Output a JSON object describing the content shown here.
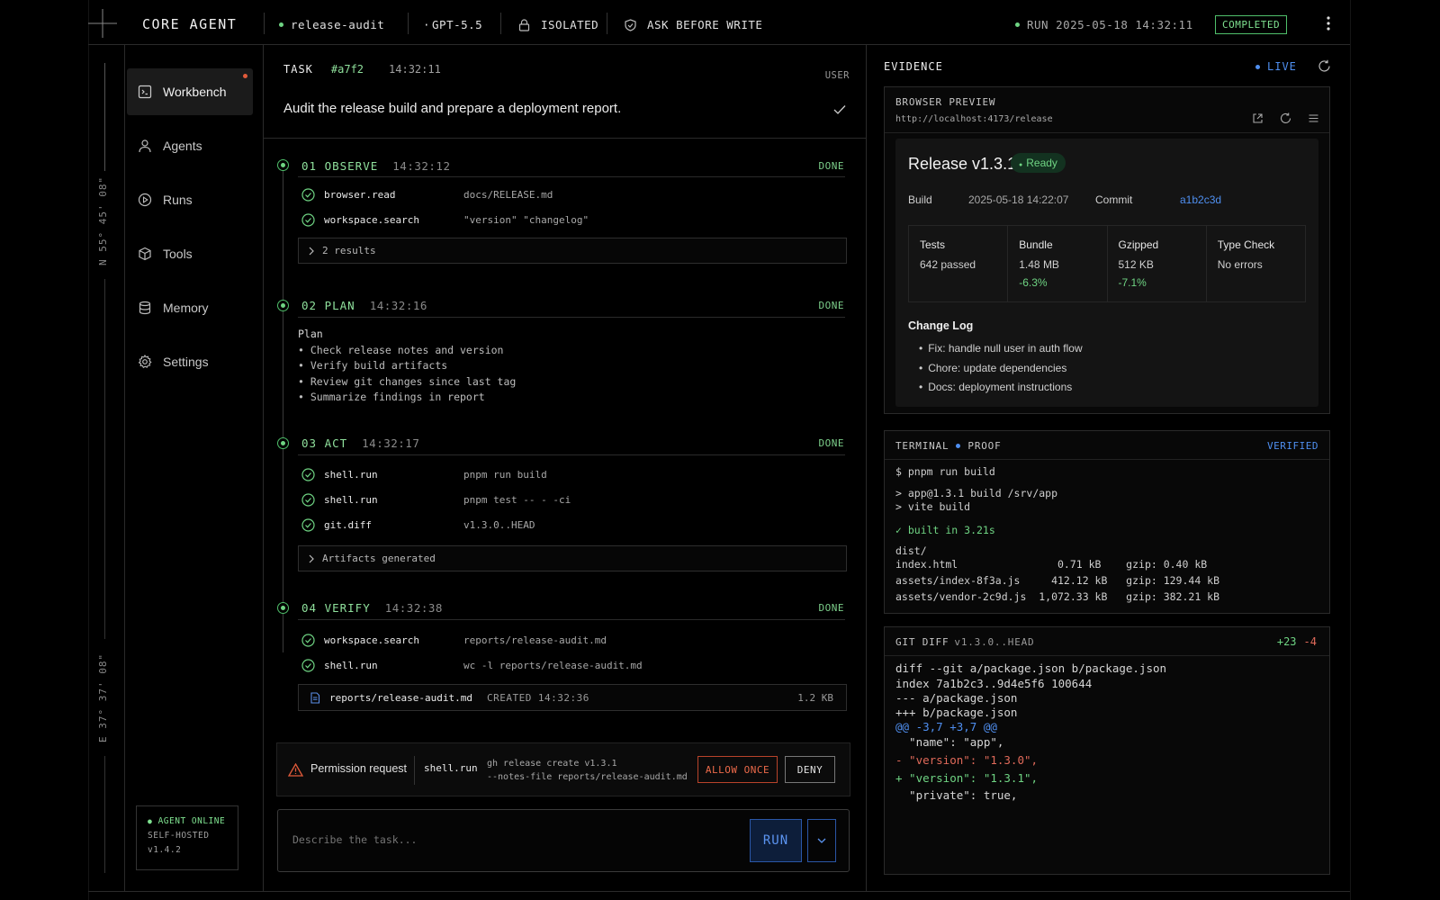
{
  "app": {
    "brand": "CORE AGENT"
  },
  "topbar": {
    "project": "release-audit",
    "model": "GPT-5.5",
    "sandbox": "ISOLATED",
    "policy": "ASK BEFORE WRITE",
    "run_label": "RUN 2025-05-18 14:32:11",
    "run_status": "COMPLETED"
  },
  "rail": {
    "coord_top": "N 55° 45' 08\"",
    "coord_bottom": "E 37° 37' 08\""
  },
  "sidebar": {
    "items": [
      {
        "label": "Workbench",
        "icon": "workbench-icon"
      },
      {
        "label": "Agents",
        "icon": "user-icon"
      },
      {
        "label": "Runs",
        "icon": "play-circle-icon"
      },
      {
        "label": "Tools",
        "icon": "box-icon"
      },
      {
        "label": "Memory",
        "icon": "database-icon"
      },
      {
        "label": "Settings",
        "icon": "gear-icon"
      }
    ],
    "status": {
      "online": "AGENT ONLINE",
      "mode": "SELF-HOSTED",
      "version": "v1.4.2"
    }
  },
  "task": {
    "label": "TASK",
    "id": "#a7f2",
    "time": "14:32:11",
    "role": "USER",
    "text": "Audit the release build and prepare a deployment report."
  },
  "steps": [
    {
      "title": "01 OBSERVE",
      "time": "14:32:12",
      "status": "DONE",
      "tools": [
        {
          "name": "browser.read",
          "arg": "docs/RELEASE.md"
        },
        {
          "name": "workspace.search",
          "arg": "\"version\" \"changelog\""
        }
      ],
      "expander": "2 results"
    },
    {
      "title": "02 PLAN",
      "time": "14:32:16",
      "status": "DONE",
      "plan_title": "Plan",
      "plan": [
        "• Check release notes and version",
        "• Verify build artifacts",
        "• Review git changes since last tag",
        "• Summarize findings in report"
      ]
    },
    {
      "title": "03 ACT",
      "time": "14:32:17",
      "status": "DONE",
      "tools": [
        {
          "name": "shell.run",
          "arg": "pnpm run build"
        },
        {
          "name": "shell.run",
          "arg": "pnpm test -- - -ci"
        },
        {
          "name": "git.diff",
          "arg": "v1.3.0..HEAD"
        }
      ],
      "expander": "Artifacts generated"
    },
    {
      "title": "04 VERIFY",
      "time": "14:32:38",
      "status": "DONE",
      "tools": [
        {
          "name": "workspace.search",
          "arg": "reports/release-audit.md"
        },
        {
          "name": "shell.run",
          "arg": "wc -l reports/release-audit.md"
        }
      ],
      "file": {
        "name": "reports/release-audit.md",
        "meta": "CREATED 14:32:36",
        "size": "1.2 KB"
      }
    }
  ],
  "permission": {
    "label": "Permission request",
    "tool": "shell.run",
    "cmd1": "gh release create v1.3.1",
    "cmd2": "--notes-file reports/release-audit.md",
    "allow": "ALLOW ONCE",
    "deny": "DENY"
  },
  "composer": {
    "placeholder": "Describe the task...",
    "run": "RUN"
  },
  "evidence": {
    "title": "EVIDENCE",
    "live": "LIVE",
    "browser": {
      "label": "BROWSER PREVIEW",
      "url": "http://localhost:4173/release",
      "release_title": "Release v1.3.1",
      "ready": "Ready",
      "build_label": "Build",
      "build_value": "2025-05-18 14:22:07",
      "commit_label": "Commit",
      "commit_value": "a1b2c3d",
      "stats": [
        {
          "h": "Tests",
          "v": "642 passed",
          "d": ""
        },
        {
          "h": "Bundle",
          "v": "1.48 MB",
          "d": "-6.3%"
        },
        {
          "h": "Gzipped",
          "v": "512 KB",
          "d": "-7.1%"
        },
        {
          "h": "Type Check",
          "v": "No errors",
          "d": ""
        }
      ],
      "changelog_title": "Change Log",
      "changelog": [
        "Fix: handle null user in auth flow",
        "Chore: update dependencies",
        "Docs: deployment instructions"
      ]
    },
    "terminal": {
      "label": "TERMINAL",
      "proof": "PROOF",
      "verified": "VERIFIED",
      "lines": [
        "$ pnpm run build",
        "> app@1.3.1 build /srv/app",
        "> vite build",
        "✓ built in 3.21s",
        "dist/",
        "index.html                0.71 kB    gzip: 0.40 kB",
        "assets/index-8f3a.js     412.12 kB   gzip: 129.44 kB",
        "assets/vendor-2c9d.js  1,072.33 kB   gzip: 382.21 kB"
      ]
    },
    "diff": {
      "label": "GIT DIFF",
      "range": "v1.3.0..HEAD",
      "added": "+23",
      "removed": "-4",
      "lines": [
        "diff --git a/package.json b/package.json",
        "index 7a1b2c3..9d4e5f6 100644",
        "--- a/package.json",
        "+++ b/package.json",
        "@@ -3,7 +3,7 @@",
        "  \"name\": \"app\",",
        "- \"version\": \"1.3.0\",",
        "+ \"version\": \"1.3.1\",",
        "  \"private\": true,"
      ]
    }
  },
  "colors": {
    "accent_green": "#6fd483",
    "accent_blue": "#4f8ff0",
    "danger": "#e05a3a",
    "diff_remove": "#e06a5a"
  }
}
